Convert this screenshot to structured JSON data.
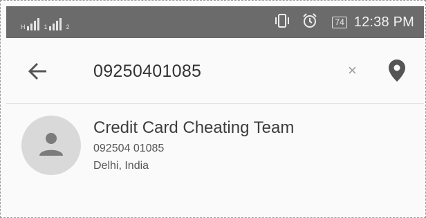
{
  "status_bar": {
    "carrier_1_label": "H",
    "carrier_2_label": "1",
    "carrier_3_label": "2",
    "battery_level": "74",
    "time": "12:38 PM",
    "icons": [
      "signal-icon",
      "vibrate-icon",
      "alarm-icon",
      "battery-icon"
    ]
  },
  "search_bar": {
    "query": "09250401085",
    "clear_label": "×",
    "icons": [
      "back-arrow-icon",
      "location-pin-icon"
    ]
  },
  "results": [
    {
      "name": "Credit Card Cheating Team",
      "number": "092504 01085",
      "location": "Delhi, India",
      "avatar_icon": "person-icon"
    }
  ],
  "colors": {
    "status_bar_bg": "#6b6b6b",
    "avatar_bg": "#d9d9d9",
    "text_primary": "#3d3d3d",
    "text_secondary": "#555555"
  }
}
